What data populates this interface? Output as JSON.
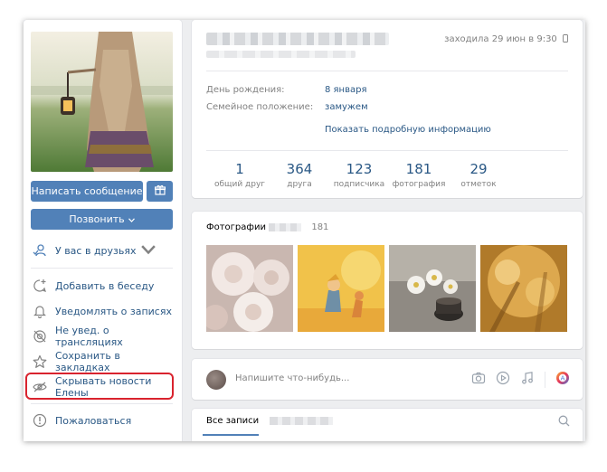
{
  "profile": {
    "last_seen": "заходила 29 июн в 9:30",
    "birthday_label": "День рождения:",
    "birthday_value": "8 января",
    "marital_label": "Семейное положение:",
    "marital_value": "замужем",
    "show_more": "Показать подробную информацию"
  },
  "counters": [
    {
      "num": "1",
      "cap": "общий друг"
    },
    {
      "num": "364",
      "cap": "друга"
    },
    {
      "num": "123",
      "cap": "подписчика"
    },
    {
      "num": "181",
      "cap": "фотография"
    },
    {
      "num": "29",
      "cap": "отметок"
    }
  ],
  "buttons": {
    "write_message": "Написать сообщение",
    "call": "Позвонить"
  },
  "sidebar": {
    "friends_status": "У вас в друзьях",
    "items": [
      {
        "label": "Добавить в беседу",
        "icon": "chat-add-icon"
      },
      {
        "label": "Уведомлять о записях",
        "icon": "bell-icon"
      },
      {
        "label": "Не увед. о трансляциях",
        "icon": "broadcast-off-icon"
      },
      {
        "label": "Сохранить в закладках",
        "icon": "star-icon"
      },
      {
        "label": "Скрывать новости Елены",
        "icon": "eye-hidden-icon"
      }
    ],
    "report": "Пожаловаться"
  },
  "photos": {
    "title": "Фотографии",
    "count": "181"
  },
  "post": {
    "placeholder": "Напишите что-нибудь..."
  },
  "wall": {
    "tab_all": "Все записи"
  },
  "colors": {
    "accent": "#5181b8",
    "link": "#2a5885",
    "highlight": "#d9232e"
  }
}
